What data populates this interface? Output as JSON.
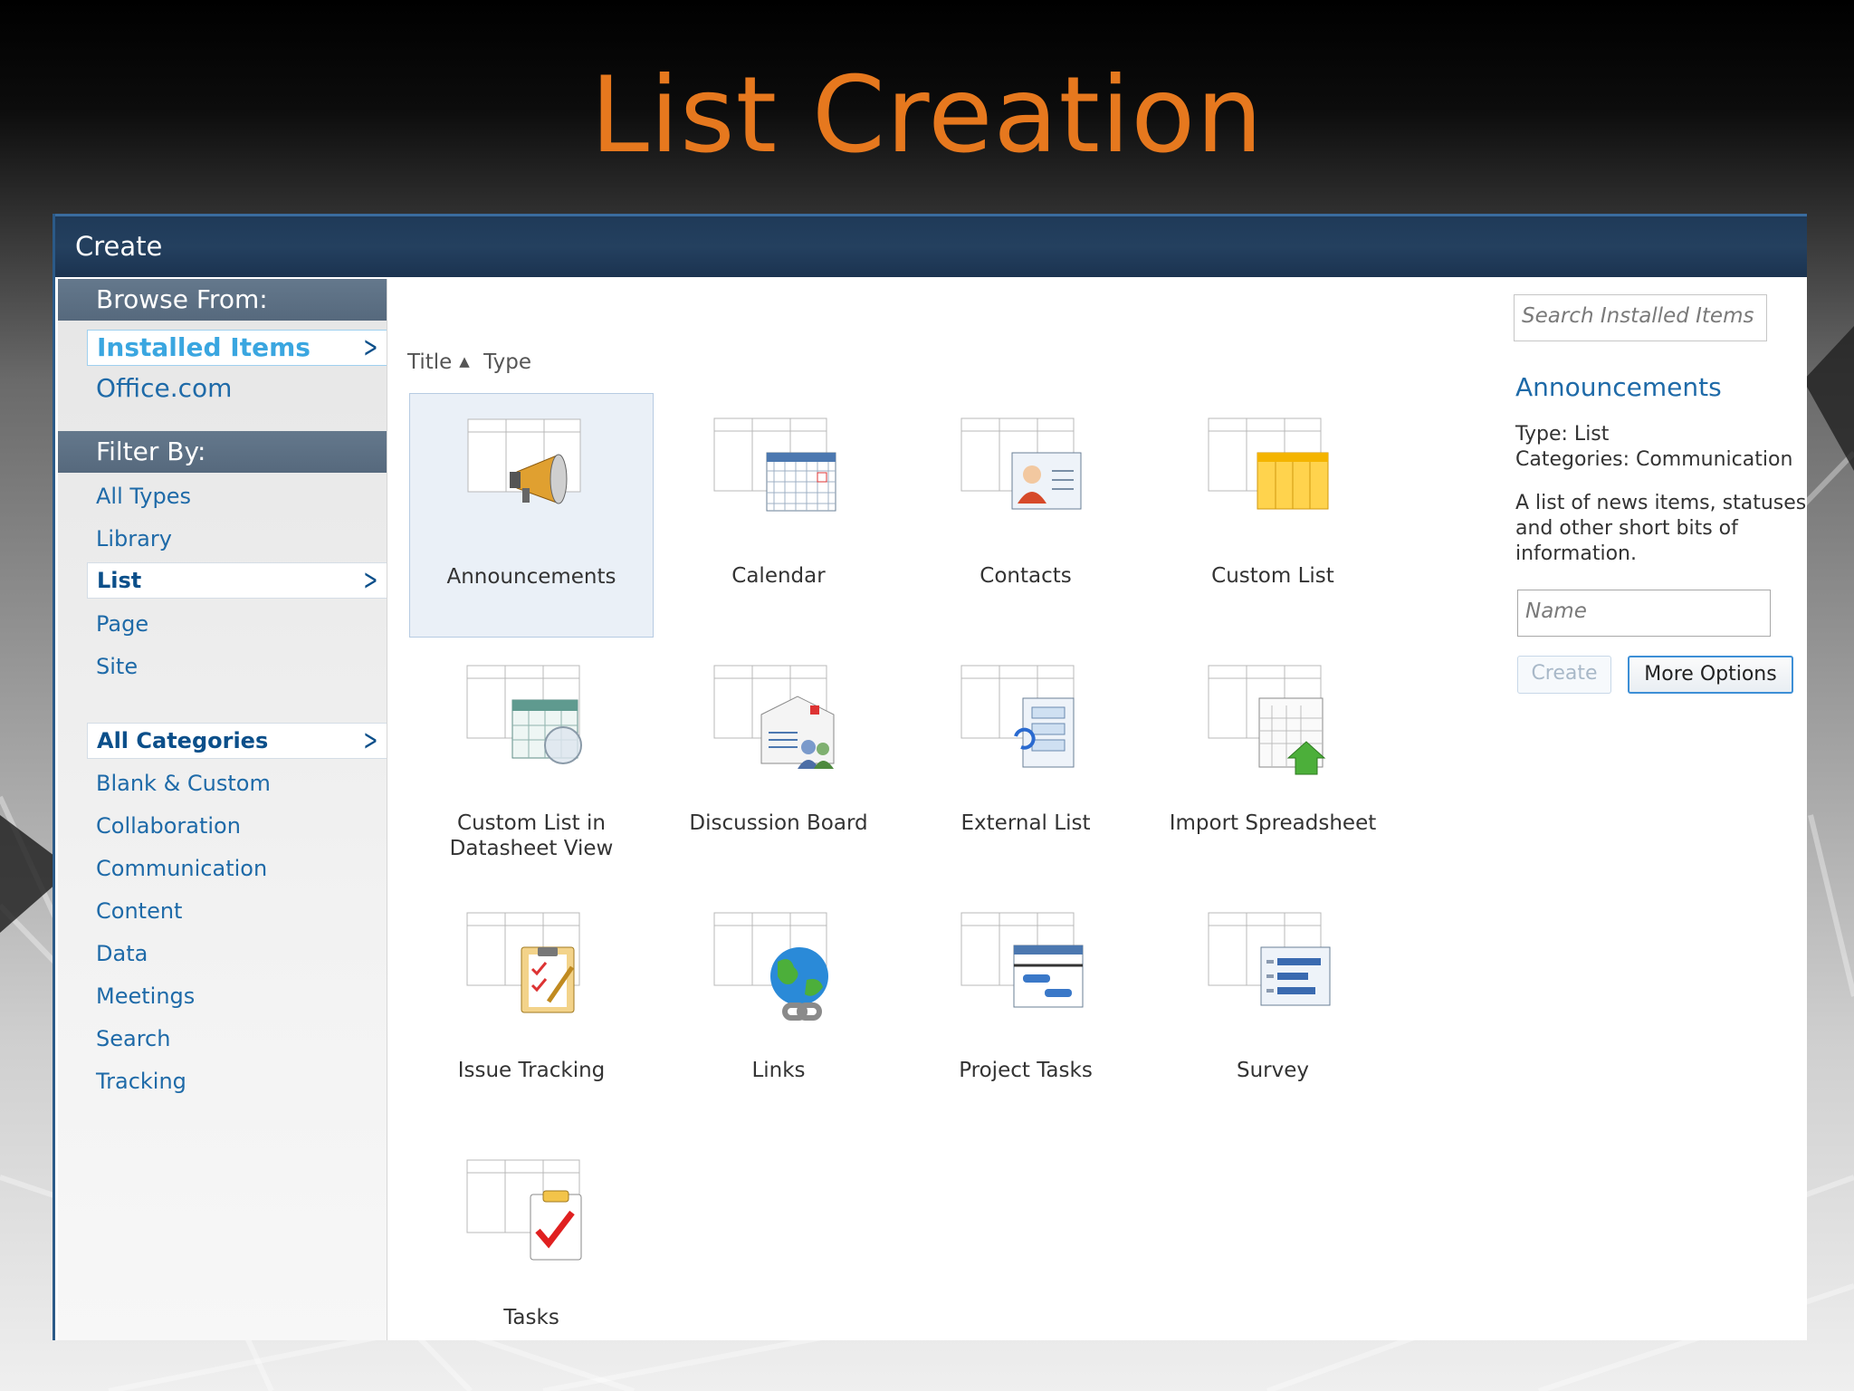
{
  "slide_title": "List Creation",
  "window": {
    "title": "Create"
  },
  "sidebar": {
    "browse_heading": "Browse From:",
    "browse_items": [
      {
        "label": "Installed Items",
        "selected": true
      },
      {
        "label": "Office.com",
        "selected": false
      }
    ],
    "filter_heading": "Filter By:",
    "type_filters": [
      {
        "label": "All Types",
        "selected": false
      },
      {
        "label": "Library",
        "selected": false
      },
      {
        "label": "List",
        "selected": true
      },
      {
        "label": "Page",
        "selected": false
      },
      {
        "label": "Site",
        "selected": false
      }
    ],
    "category_filters": [
      {
        "label": "All Categories",
        "selected": true
      },
      {
        "label": "Blank & Custom",
        "selected": false
      },
      {
        "label": "Collaboration",
        "selected": false
      },
      {
        "label": "Communication",
        "selected": false
      },
      {
        "label": "Content",
        "selected": false
      },
      {
        "label": "Data",
        "selected": false
      },
      {
        "label": "Meetings",
        "selected": false
      },
      {
        "label": "Search",
        "selected": false
      },
      {
        "label": "Tracking",
        "selected": false
      }
    ]
  },
  "sort": {
    "title_label": "Title",
    "type_label": "Type"
  },
  "templates": [
    {
      "label": "Announcements",
      "icon": "megaphone-icon",
      "selected": true
    },
    {
      "label": "Calendar",
      "icon": "calendar-icon",
      "selected": false
    },
    {
      "label": "Contacts",
      "icon": "contact-card-icon",
      "selected": false
    },
    {
      "label": "Custom List",
      "icon": "custom-list-icon",
      "selected": false
    },
    {
      "label": "Custom List in Datasheet View",
      "icon": "datasheet-icon",
      "selected": false
    },
    {
      "label": "Discussion Board",
      "icon": "discussion-icon",
      "selected": false
    },
    {
      "label": "External List",
      "icon": "external-list-icon",
      "selected": false
    },
    {
      "label": "Import Spreadsheet",
      "icon": "import-spreadsheet-icon",
      "selected": false
    },
    {
      "label": "Issue Tracking",
      "icon": "clipboard-icon",
      "selected": false
    },
    {
      "label": "Links",
      "icon": "globe-link-icon",
      "selected": false
    },
    {
      "label": "Project Tasks",
      "icon": "gantt-icon",
      "selected": false
    },
    {
      "label": "Survey",
      "icon": "survey-icon",
      "selected": false
    },
    {
      "label": "Tasks",
      "icon": "task-check-icon",
      "selected": false
    }
  ],
  "details": {
    "search_placeholder": "Search Installed Items",
    "title": "Announcements",
    "type_line": "Type: List",
    "categories_line": "Categories: Communication",
    "description": "A list of news items, statuses and other short bits of information.",
    "name_placeholder": "Name",
    "create_label": "Create",
    "more_options_label": "More Options"
  },
  "colors": {
    "title_orange": "#e6781e",
    "titlebar_navy": "#1f3a58",
    "link_blue": "#1e6aa8",
    "section_header": "#5d7185"
  }
}
